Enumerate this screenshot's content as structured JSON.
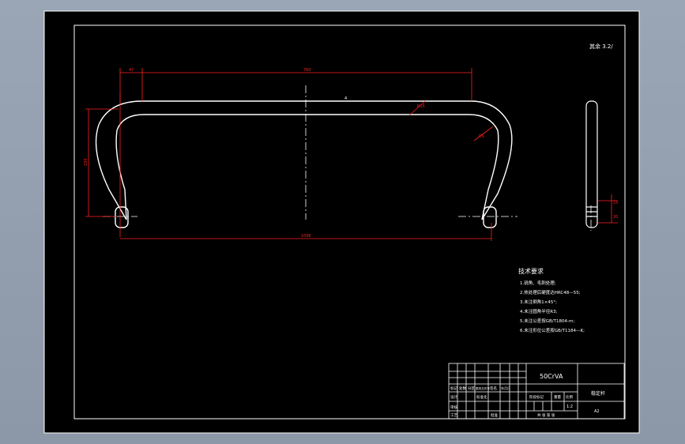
{
  "drawing": {
    "scale_note": "其余 3.2/",
    "dims": {
      "left_offset": "47",
      "top_span": "760",
      "bottom_span": "1096",
      "height": "230",
      "radius_top": "R15",
      "radius_bend": "R5",
      "side_upper": "15",
      "side_lower": "20"
    },
    "center_mark": "4"
  },
  "tech": {
    "title": "技术要求",
    "items": [
      "1.锐角、毛刺处理;",
      "2.热处理后硬度达HRC48—55;",
      "3.未注倒角1×45°;",
      "4.未注圆角半径R3;",
      "5.未注公差按GB/T1804-m;",
      "6.未注形位公差按GB/T1184—K;"
    ]
  },
  "title_block": {
    "material": "50CrVA",
    "part_name": "稳定杆",
    "labels": {
      "mark": "标记",
      "count": "处数",
      "zone": "分区",
      "change_no": "更改文件号",
      "sign": "签名",
      "date": "年月日",
      "design": "设计",
      "standardize": "标准化",
      "stage_mark": "阶段标记",
      "weight": "重量",
      "scale": "比例",
      "review": "审核",
      "process": "工艺",
      "approve": "批准",
      "sheets": "共 张 第 张"
    },
    "scale_value": "1:2",
    "drawing_code": "A2"
  }
}
